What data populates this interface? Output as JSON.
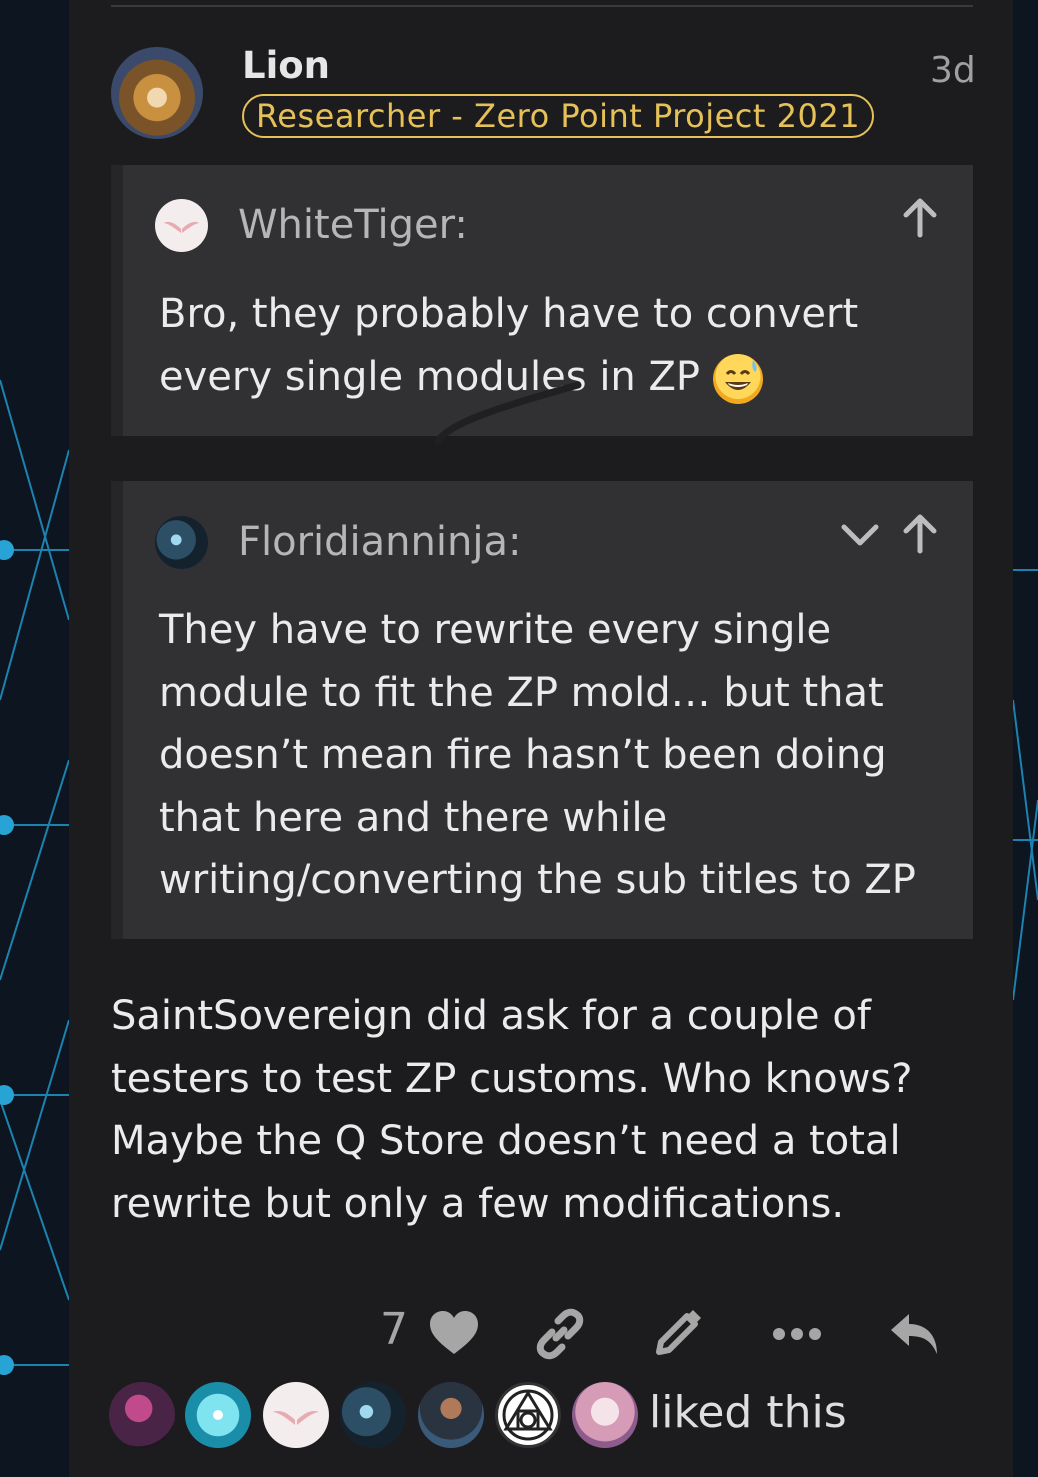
{
  "post": {
    "author": "Lion",
    "flair": "Researcher - Zero Point Project 2021",
    "timestamp": "3d",
    "body": "SaintSovereign did ask for a couple of testers to test ZP customs. Who knows? Maybe the Q Store doesn’t need a total rewrite but only a few modifications."
  },
  "quotes": [
    {
      "author": "WhiteTiger:",
      "text": "Bro, they probably have to convert every single modules in ZP",
      "emoji": "grinning-sweat-emoji"
    },
    {
      "author": "Floridianninja:",
      "text": "They have to rewrite every single module to fit the ZP mold… but that doesn’t mean fire hasn’t been doing that here and there while writing/converting the sub titles to ZP"
    }
  ],
  "actions": {
    "like_count": "7",
    "icons": [
      "heart-icon",
      "link-icon",
      "pencil-icon",
      "more-icon",
      "reply-icon"
    ]
  },
  "likers": {
    "count_avatars": 7,
    "label": "liked this"
  },
  "colors": {
    "flair": "#e5c158",
    "post_bg": "#1c1c1e",
    "quote_bg": "#313133"
  }
}
